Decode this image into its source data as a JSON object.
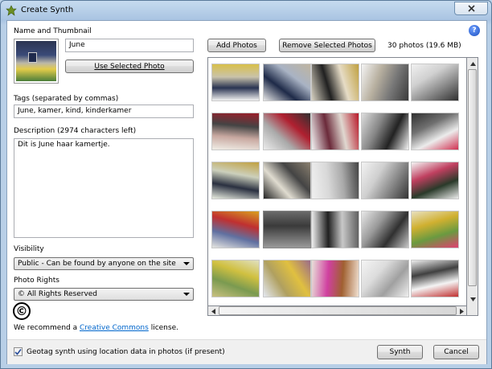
{
  "window": {
    "title": "Create Synth"
  },
  "left": {
    "name_label": "Name and Thumbnail",
    "name_value": "June",
    "use_selected_label": "Use Selected Photo",
    "tags_label": "Tags (separated by commas)",
    "tags_value": "June, kamer, kind, kinderkamer",
    "description_label": "Description (2974 characters left)",
    "description_value": "Dit is June haar kamertje.",
    "visibility_label": "Visibility",
    "visibility_value": "Public - Can be found by anyone on the site",
    "rights_label": "Photo Rights",
    "rights_value": "© All Rights Reserved",
    "cc_symbol": "©",
    "recommend_prefix": "We recommend a ",
    "recommend_link": "Creative Commons",
    "recommend_suffix": " license."
  },
  "right": {
    "add_photos_label": "Add Photos",
    "remove_label": "Remove Selected Photos",
    "photo_count": "30 photos (19.6 MB)"
  },
  "footer": {
    "geotag_label": "Geotag synth using location data in photos (if present)",
    "geotag_checked": true,
    "synth_label": "Synth",
    "cancel_label": "Cancel"
  },
  "colors": {
    "accent": "#0066cc"
  }
}
